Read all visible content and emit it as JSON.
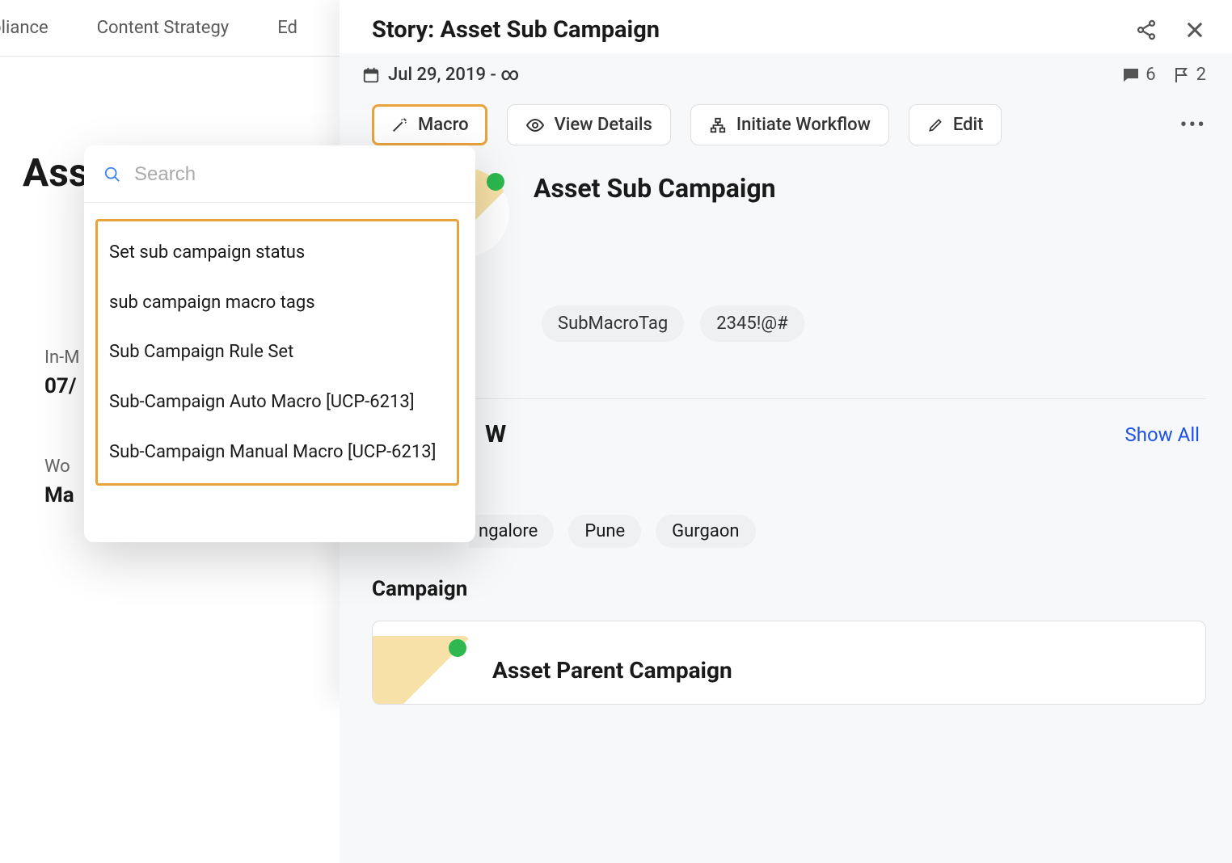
{
  "nav": {
    "item1": "mpliance",
    "item2": "Content Strategy",
    "item3": "Ed"
  },
  "left": {
    "heading": "Asse",
    "label1": "In-M",
    "value1": "07/",
    "label2": "Wo",
    "value2": "Ma"
  },
  "dropdown": {
    "search_placeholder": "Search",
    "items": [
      "Set sub campaign status",
      "sub campaign macro tags",
      "Sub Campaign Rule Set",
      "Sub-Campaign Auto Macro [UCP-6213]",
      "Sub-Campaign Manual Macro [UCP-6213]"
    ]
  },
  "panel": {
    "header_title": "Story: Asset Sub Campaign",
    "date": "Jul 29, 2019 - ∞",
    "comments": "6",
    "flags": "2",
    "toolbar": {
      "macro": "Macro",
      "view_details": "View Details",
      "initiate_workflow": "Initiate Workflow",
      "edit": "Edit"
    },
    "main_title": "Asset Sub Campaign",
    "tags": [
      "SubMacroTag",
      "2345!@#"
    ],
    "section_w": "W",
    "show_all": "Show All",
    "cities": [
      "ngalore",
      "Pune",
      "Gurgaon"
    ],
    "campaign_heading": "Campaign",
    "parent_campaign": "Asset Parent Campaign"
  }
}
